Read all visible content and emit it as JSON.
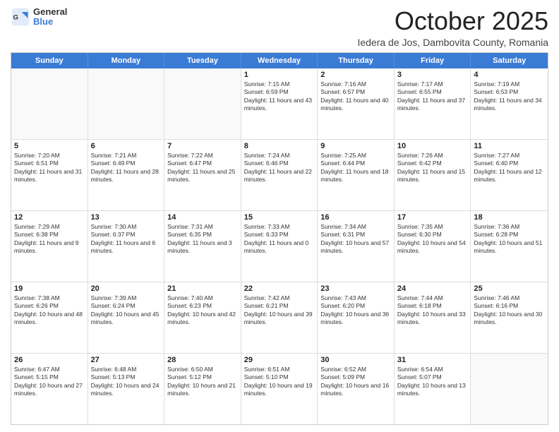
{
  "logo": {
    "general": "General",
    "blue": "Blue"
  },
  "header": {
    "month": "October 2025",
    "location": "Iedera de Jos, Dambovita County, Romania"
  },
  "days": [
    "Sunday",
    "Monday",
    "Tuesday",
    "Wednesday",
    "Thursday",
    "Friday",
    "Saturday"
  ],
  "rows": [
    [
      {
        "num": "",
        "text": ""
      },
      {
        "num": "",
        "text": ""
      },
      {
        "num": "",
        "text": ""
      },
      {
        "num": "1",
        "text": "Sunrise: 7:15 AM\nSunset: 6:59 PM\nDaylight: 11 hours and 43 minutes."
      },
      {
        "num": "2",
        "text": "Sunrise: 7:16 AM\nSunset: 6:57 PM\nDaylight: 11 hours and 40 minutes."
      },
      {
        "num": "3",
        "text": "Sunrise: 7:17 AM\nSunset: 6:55 PM\nDaylight: 11 hours and 37 minutes."
      },
      {
        "num": "4",
        "text": "Sunrise: 7:19 AM\nSunset: 6:53 PM\nDaylight: 11 hours and 34 minutes."
      }
    ],
    [
      {
        "num": "5",
        "text": "Sunrise: 7:20 AM\nSunset: 6:51 PM\nDaylight: 11 hours and 31 minutes."
      },
      {
        "num": "6",
        "text": "Sunrise: 7:21 AM\nSunset: 6:49 PM\nDaylight: 11 hours and 28 minutes."
      },
      {
        "num": "7",
        "text": "Sunrise: 7:22 AM\nSunset: 6:47 PM\nDaylight: 11 hours and 25 minutes."
      },
      {
        "num": "8",
        "text": "Sunrise: 7:24 AM\nSunset: 6:46 PM\nDaylight: 11 hours and 22 minutes."
      },
      {
        "num": "9",
        "text": "Sunrise: 7:25 AM\nSunset: 6:44 PM\nDaylight: 11 hours and 18 minutes."
      },
      {
        "num": "10",
        "text": "Sunrise: 7:26 AM\nSunset: 6:42 PM\nDaylight: 11 hours and 15 minutes."
      },
      {
        "num": "11",
        "text": "Sunrise: 7:27 AM\nSunset: 6:40 PM\nDaylight: 11 hours and 12 minutes."
      }
    ],
    [
      {
        "num": "12",
        "text": "Sunrise: 7:29 AM\nSunset: 6:38 PM\nDaylight: 11 hours and 9 minutes."
      },
      {
        "num": "13",
        "text": "Sunrise: 7:30 AM\nSunset: 6:37 PM\nDaylight: 11 hours and 6 minutes."
      },
      {
        "num": "14",
        "text": "Sunrise: 7:31 AM\nSunset: 6:35 PM\nDaylight: 11 hours and 3 minutes."
      },
      {
        "num": "15",
        "text": "Sunrise: 7:33 AM\nSunset: 6:33 PM\nDaylight: 11 hours and 0 minutes."
      },
      {
        "num": "16",
        "text": "Sunrise: 7:34 AM\nSunset: 6:31 PM\nDaylight: 10 hours and 57 minutes."
      },
      {
        "num": "17",
        "text": "Sunrise: 7:35 AM\nSunset: 6:30 PM\nDaylight: 10 hours and 54 minutes."
      },
      {
        "num": "18",
        "text": "Sunrise: 7:36 AM\nSunset: 6:28 PM\nDaylight: 10 hours and 51 minutes."
      }
    ],
    [
      {
        "num": "19",
        "text": "Sunrise: 7:38 AM\nSunset: 6:26 PM\nDaylight: 10 hours and 48 minutes."
      },
      {
        "num": "20",
        "text": "Sunrise: 7:39 AM\nSunset: 6:24 PM\nDaylight: 10 hours and 45 minutes."
      },
      {
        "num": "21",
        "text": "Sunrise: 7:40 AM\nSunset: 6:23 PM\nDaylight: 10 hours and 42 minutes."
      },
      {
        "num": "22",
        "text": "Sunrise: 7:42 AM\nSunset: 6:21 PM\nDaylight: 10 hours and 39 minutes."
      },
      {
        "num": "23",
        "text": "Sunrise: 7:43 AM\nSunset: 6:20 PM\nDaylight: 10 hours and 36 minutes."
      },
      {
        "num": "24",
        "text": "Sunrise: 7:44 AM\nSunset: 6:18 PM\nDaylight: 10 hours and 33 minutes."
      },
      {
        "num": "25",
        "text": "Sunrise: 7:46 AM\nSunset: 6:16 PM\nDaylight: 10 hours and 30 minutes."
      }
    ],
    [
      {
        "num": "26",
        "text": "Sunrise: 6:47 AM\nSunset: 5:15 PM\nDaylight: 10 hours and 27 minutes."
      },
      {
        "num": "27",
        "text": "Sunrise: 6:48 AM\nSunset: 5:13 PM\nDaylight: 10 hours and 24 minutes."
      },
      {
        "num": "28",
        "text": "Sunrise: 6:50 AM\nSunset: 5:12 PM\nDaylight: 10 hours and 21 minutes."
      },
      {
        "num": "29",
        "text": "Sunrise: 6:51 AM\nSunset: 5:10 PM\nDaylight: 10 hours and 19 minutes."
      },
      {
        "num": "30",
        "text": "Sunrise: 6:52 AM\nSunset: 5:09 PM\nDaylight: 10 hours and 16 minutes."
      },
      {
        "num": "31",
        "text": "Sunrise: 6:54 AM\nSunset: 5:07 PM\nDaylight: 10 hours and 13 minutes."
      },
      {
        "num": "",
        "text": ""
      }
    ]
  ]
}
